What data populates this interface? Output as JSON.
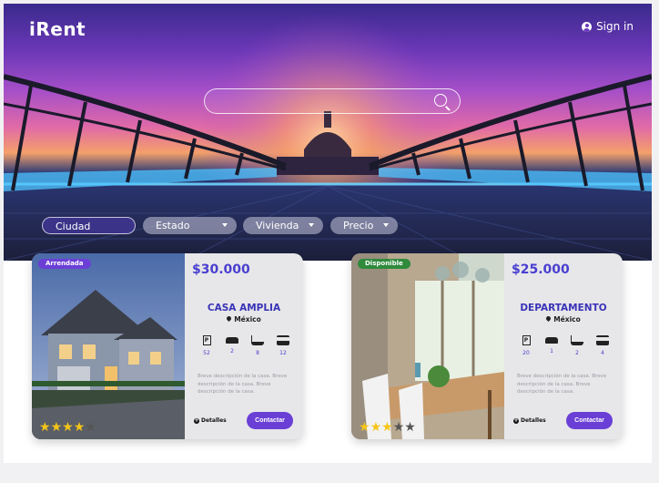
{
  "header": {
    "logo": "iRent",
    "signin_label": "Sign in"
  },
  "search": {
    "placeholder": ""
  },
  "filters": [
    {
      "label": "Ciudad"
    },
    {
      "label": "Estado"
    },
    {
      "label": "Vivienda"
    },
    {
      "label": "Precio"
    }
  ],
  "listings": [
    {
      "status": "Arrendada",
      "price": "$30.000",
      "type": "CASA AMPLIA",
      "location": "México",
      "amenities": {
        "parking": "52",
        "cars": "2",
        "baths": "8",
        "beds": "12"
      },
      "description": "Breve descripción de la casa. Breve descripción de la casa. Breve descripción de la casa.",
      "rating": 4,
      "details_label": "Detalles",
      "contact_label": "Contactar"
    },
    {
      "status": "Disponible",
      "price": "$25.000",
      "type": "DEPARTAMENTO",
      "location": "México",
      "amenities": {
        "parking": "20",
        "cars": "1",
        "baths": "2",
        "beds": "4"
      },
      "description": "Breve descripción de la casa. Breve descripción de la casa. Breve descripción de la casa.",
      "rating": 3,
      "details_label": "Detalles",
      "contact_label": "Contactar"
    }
  ],
  "colors": {
    "accent": "#6a3fd6",
    "price": "#4a3fd0",
    "rented_badge": "#6b3fd6",
    "available_badge": "#2f8a3c",
    "star": "#f5c518"
  }
}
